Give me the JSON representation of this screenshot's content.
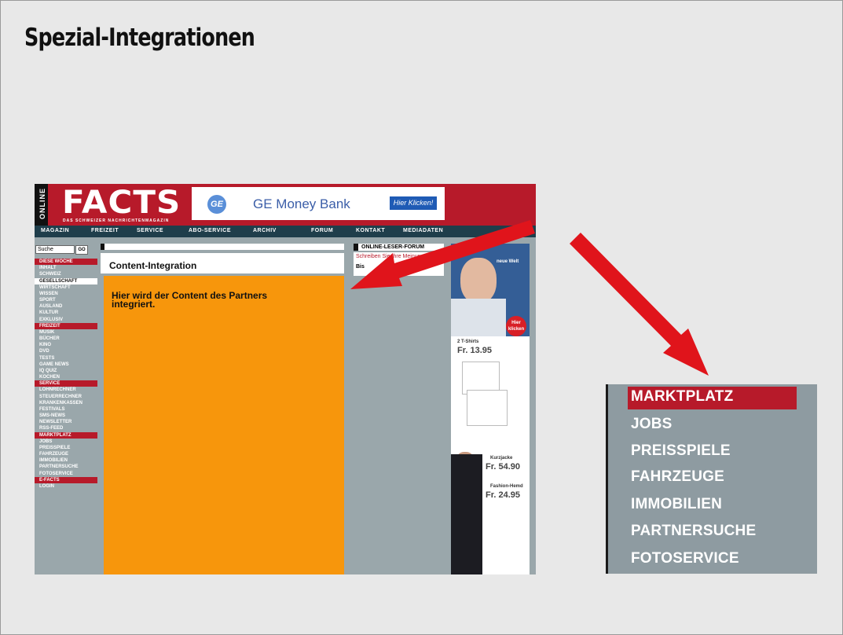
{
  "slide": {
    "title": "Spezial-Integrationen"
  },
  "site": {
    "logo_vertical": "ONLINE",
    "logo": "FACTS",
    "logo_tagline": "DAS SCHWEIZER NACHRICHTENMAGAZIN",
    "ad": {
      "brand_mark": "GE",
      "text": "GE Money Bank",
      "button": "Hier Klicken!"
    },
    "nav": [
      "MAGAZIN",
      "FREIZEIT",
      "SERVICE",
      "ABO-SERVICE",
      "ARCHIV",
      "FORUM",
      "KONTAKT",
      "MEDIADATEN"
    ],
    "search_placeholder": "Suche",
    "go_label": "GO",
    "sidebar": [
      {
        "label": "DIESE WOCHE",
        "type": "head"
      },
      {
        "label": "INHALT"
      },
      {
        "label": "SCHWEIZ"
      },
      {
        "label": "GESELLSCHAFT",
        "type": "active"
      },
      {
        "label": "WIRTSCHAFT"
      },
      {
        "label": "WISSEN"
      },
      {
        "label": "SPORT"
      },
      {
        "label": "AUSLAND"
      },
      {
        "label": "KULTUR"
      },
      {
        "label": "EXKLUSIV"
      },
      {
        "label": "FREIZEIT",
        "type": "head"
      },
      {
        "label": "MUSIK"
      },
      {
        "label": "BÜCHER"
      },
      {
        "label": "KINO"
      },
      {
        "label": "DVD"
      },
      {
        "label": "TESTS"
      },
      {
        "label": "GAME NEWS"
      },
      {
        "label": "IQ QUIZ"
      },
      {
        "label": "KOCHEN"
      },
      {
        "label": "SERVICE",
        "type": "head"
      },
      {
        "label": "LOHNRECHNER"
      },
      {
        "label": "STEUERRECHNER"
      },
      {
        "label": "KRANKENKASSEN"
      },
      {
        "label": "FESTIVALS"
      },
      {
        "label": "SMS-NEWS"
      },
      {
        "label": "NEWSLETTER"
      },
      {
        "label": "RSS-FEED"
      },
      {
        "label": "MARKTPLATZ",
        "type": "head"
      },
      {
        "label": "JOBS"
      },
      {
        "label": "PREISSPIELE"
      },
      {
        "label": "FAHRZEUGE"
      },
      {
        "label": "IMMOBILIEN"
      },
      {
        "label": "PARTNERSUCHE"
      },
      {
        "label": "FOTOSERVICE"
      },
      {
        "label": "E-FACTS",
        "type": "head"
      },
      {
        "label": "LOGIN"
      }
    ],
    "content": {
      "title": "Content-Integration",
      "body": "Hier wird der Content des Partners integriert."
    },
    "forum": {
      "title": "ONLINE-LESER-FORUM",
      "link": "Schreiben Sie Ihre Meinung",
      "partial": "Bis"
    },
    "sky_ad": {
      "badge": "Hier klicken",
      "tshirt_label": "2 T-Shirts",
      "tshirt_price": "Fr. 13.95",
      "jacket_label": "Kurzjacke",
      "jacket_price": "Fr. 54.90",
      "shirt_label": "Fashion-Hemd",
      "shirt_price": "Fr. 24.95",
      "top_text": "neue Welt"
    }
  },
  "zoom_menu": {
    "items": [
      "MARKTPLATZ",
      "JOBS",
      "PREISSPIELE",
      "FAHRZEUGE",
      "IMMOBILIEN",
      "PARTNERSUCHE",
      "FOTOSERVICE"
    ]
  },
  "colors": {
    "brand_red": "#b71a2a",
    "nav_dark": "#1f3e4b",
    "content_orange": "#f7960c",
    "arrow_red": "#e0141b"
  }
}
